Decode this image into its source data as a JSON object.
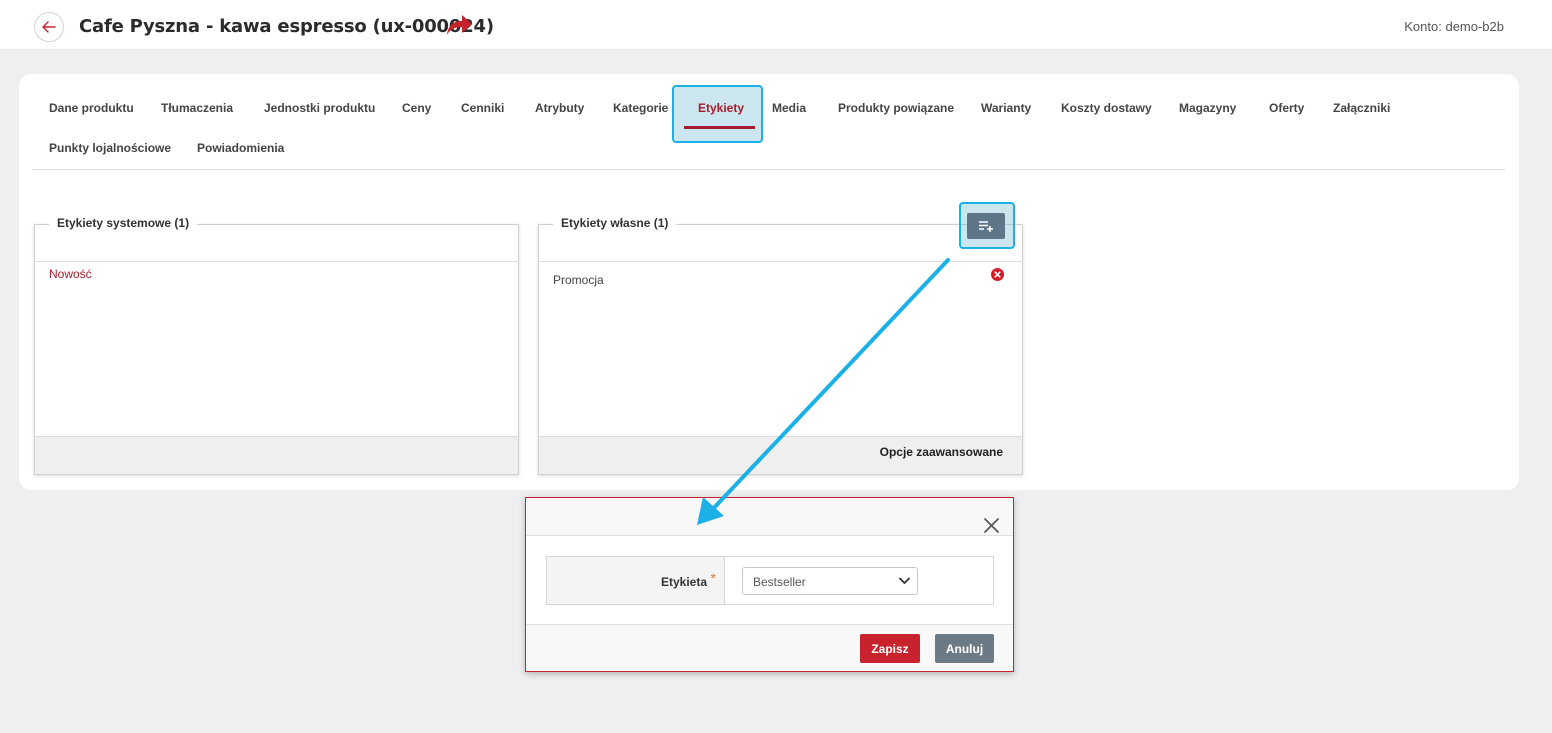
{
  "header": {
    "title": "Cafe Pyszna - kawa espresso (ux-000024)",
    "account": "Konto: demo-b2b",
    "icons": {
      "back": "arrow-left-icon",
      "share": "share-arrow-icon"
    }
  },
  "tabs": [
    {
      "label": "Dane produktu"
    },
    {
      "label": "Tłumaczenia"
    },
    {
      "label": "Jednostki produktu"
    },
    {
      "label": "Ceny"
    },
    {
      "label": "Cenniki"
    },
    {
      "label": "Atrybuty"
    },
    {
      "label": "Kategorie"
    },
    {
      "label": "Etykiety",
      "active": true
    },
    {
      "label": "Media"
    },
    {
      "label": "Produkty powiązane"
    },
    {
      "label": "Warianty"
    },
    {
      "label": "Koszty dostawy"
    },
    {
      "label": "Magazyny"
    },
    {
      "label": "Oferty"
    },
    {
      "label": "Załączniki"
    },
    {
      "label": "Punkty lojalnościowe"
    },
    {
      "label": "Powiadomienia"
    }
  ],
  "system_labels": {
    "title": "Etykiety systemowe (1)",
    "items": [
      "Nowość"
    ]
  },
  "own_labels": {
    "title": "Etykiety własne (1)",
    "items": [
      "Promocja"
    ],
    "advanced_link": "Opcje zaawansowane",
    "add_button_icon": "add-list-icon"
  },
  "modal": {
    "field_label": "Etykieta",
    "required_mark": "*",
    "select_value": "Bestseller",
    "save_label": "Zapisz",
    "cancel_label": "Anuluj"
  },
  "colors": {
    "accent": "#a51d2d",
    "highlight": "#1bb0e6",
    "save_button": "#c8232c",
    "cancel_button": "#6c7a86"
  }
}
